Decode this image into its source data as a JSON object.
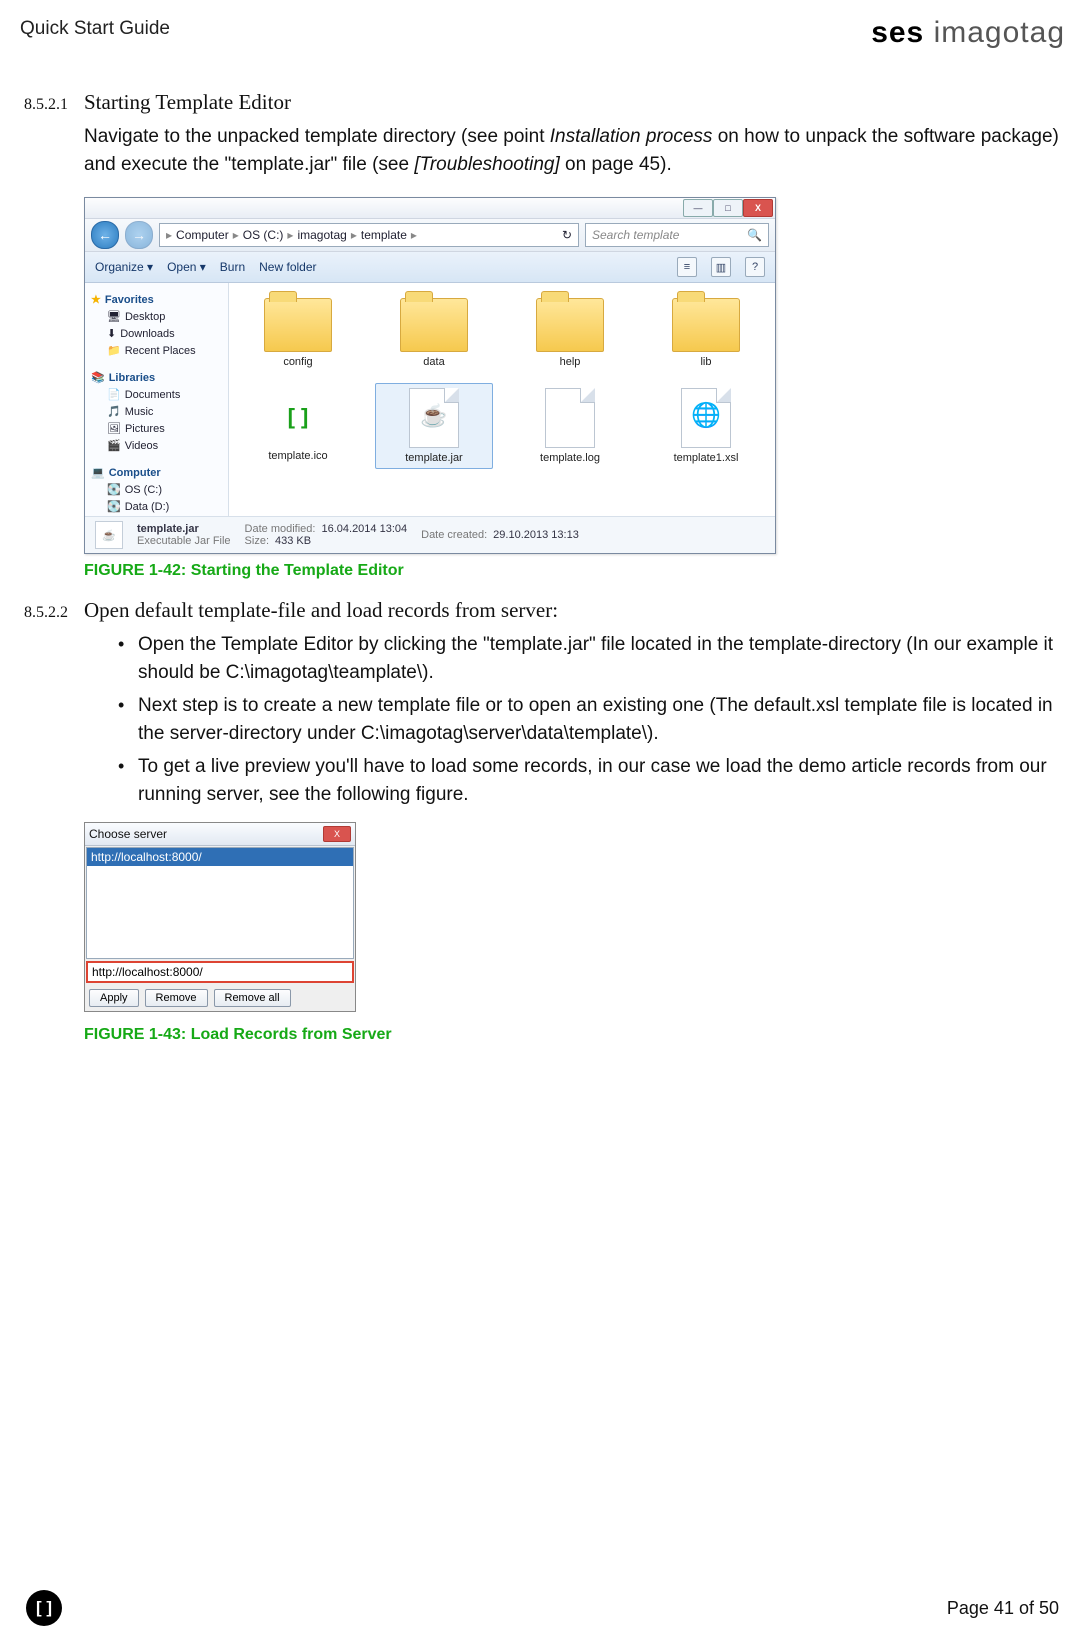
{
  "header": {
    "doc_title": "Quick Start Guide",
    "brand_bold": "ses",
    "brand_thin": " imagotag"
  },
  "section1": {
    "num": "8.5.2.1",
    "title": "Starting Template Editor",
    "para_a": "Navigate to the unpacked template directory (see point ",
    "para_em1": "Installation process",
    "para_b": " on how to unpack the software package) and execute the \"template.jar\" file (see ",
    "para_em2": "[Troubleshooting]",
    "para_c": " on page 45)."
  },
  "explorer": {
    "win_min": "—",
    "win_max": "□",
    "win_close": "X",
    "nav_back": "←",
    "nav_fwd": "→",
    "crumbs": [
      "Computer",
      "OS (C:)",
      "imagotag",
      "template"
    ],
    "crumb_sep": "▸",
    "refresh_icon": "↻",
    "search_placeholder": "Search template",
    "search_icon": "🔍",
    "toolbar": {
      "organize": "Organize ▾",
      "open": "Open ▾",
      "burn": "Burn",
      "newfolder": "New folder",
      "view_icon": "≡",
      "pane_icon": "▥",
      "help_icon": "?"
    },
    "sidebar": {
      "fav": "Favorites",
      "desktop": "Desktop",
      "downloads": "Downloads",
      "recent": "Recent Places",
      "lib": "Libraries",
      "documents": "Documents",
      "music": "Music",
      "pictures": "Pictures",
      "videos": "Videos",
      "computer": "Computer",
      "osc": "OS (C:)",
      "datad": "Data (D:)"
    },
    "files_row1": [
      "config",
      "data",
      "help",
      "lib"
    ],
    "files_row2": [
      "template.ico",
      "template.jar",
      "template.log",
      "template1.xsl"
    ],
    "status": {
      "name": "template.jar",
      "type": "Executable Jar File",
      "mod_k": "Date modified:",
      "mod_v": "16.04.2014 13:04",
      "size_k": "Size:",
      "size_v": "433 KB",
      "created_k": "Date created:",
      "created_v": "29.10.2013 13:13"
    }
  },
  "fig1_caption": "FIGURE 1-42: Starting the Template Editor",
  "section2": {
    "num": "8.5.2.2",
    "title": "Open default template-file and load records from server:",
    "b1": "Open the Template Editor by clicking the \"template.jar\" file located in the template-directory (In our example it should be C:\\imagotag\\teamplate\\).",
    "b2": "Next step is to create a new template file or to open an existing one (The default.xsl template file is located in the server-directory under C:\\imagotag\\server\\data\\template\\).",
    "b3": "To get a live preview you'll have to load some records, in our case we load the demo article records from our running server, see the following figure."
  },
  "dialog": {
    "title": "Choose server",
    "close": "X",
    "item": "http://localhost:8000/",
    "input_value": "http://localhost:8000/",
    "apply": "Apply",
    "remove": "Remove",
    "remove_all": "Remove all"
  },
  "fig2_caption": "FIGURE 1-43: Load Records from Server",
  "footer": {
    "badge": "[ ]",
    "page": "Page 41 of 50"
  }
}
